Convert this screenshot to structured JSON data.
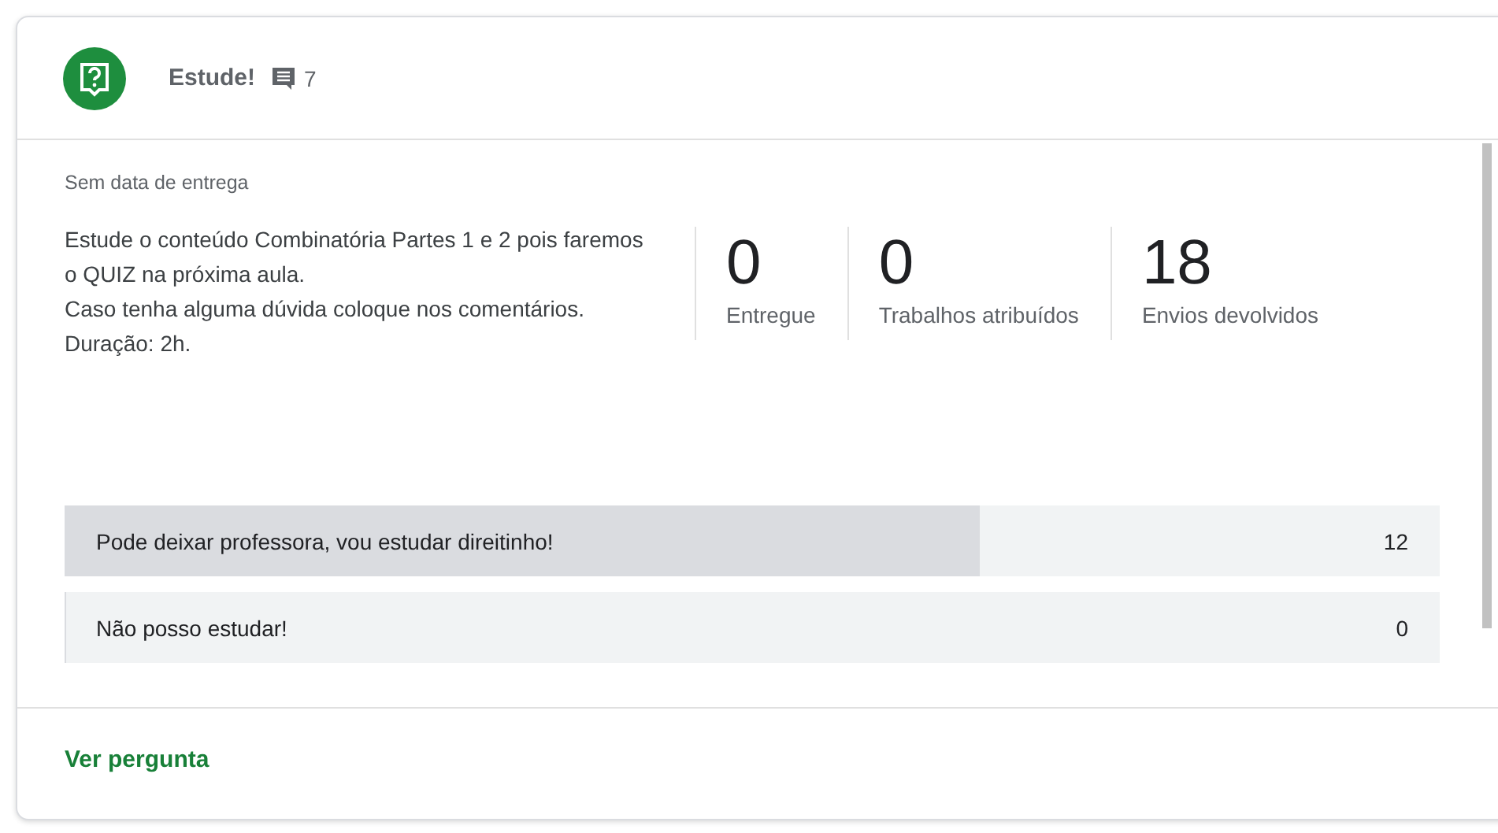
{
  "header": {
    "title": "Estude!",
    "comment_count": "7"
  },
  "due": "Sem data de entrega",
  "description": [
    "Estude o conteúdo Combinatória Partes 1 e 2 pois faremos o QUIZ na próxima aula.",
    "Caso tenha alguma dúvida coloque nos comentários.",
    "Duração: 2h."
  ],
  "stats": [
    {
      "value": "0",
      "label": "Entregue"
    },
    {
      "value": "0",
      "label": "Trabalhos atribuídos"
    },
    {
      "value": "18",
      "label": "Envios devolvidos"
    }
  ],
  "answers": [
    {
      "text": "Pode deixar professora, vou estudar direitinho!",
      "count": "12",
      "level": 0.666
    },
    {
      "text": "Não posso estudar!",
      "count": "0",
      "level": 0
    }
  ],
  "footer_link": "Ver pergunta"
}
